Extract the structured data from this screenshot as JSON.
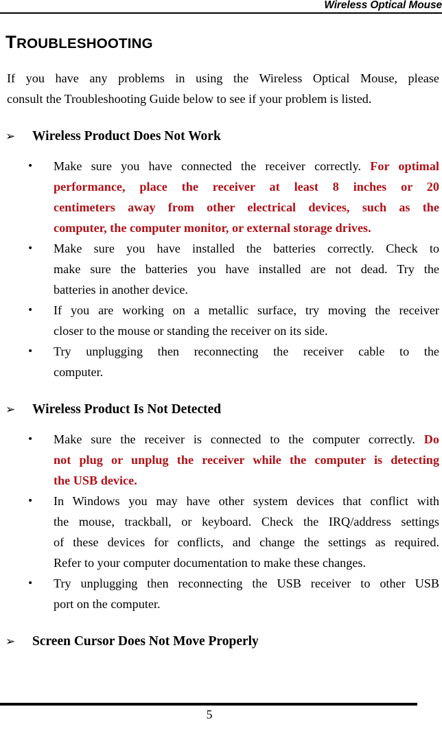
{
  "header": {
    "title": "Wireless Optical Mouse"
  },
  "document": {
    "chapter_title_first_letter": "T",
    "chapter_title_rest": "ROUBLESHOOTING",
    "chapter_title_full": "TROUBLESHOOTING",
    "intro_line_1": "If you have any problems in using the Wireless Optical Mouse, please",
    "intro_line_2": "consult the Troubleshooting Guide below to see if your problem is listed."
  },
  "theme": {
    "text_color": "#000000",
    "emphasis_color": "#B01218",
    "page_background": "#FFFFFF",
    "rule_color": "#000000"
  },
  "icons": {
    "arrow_bullet": "➢",
    "disc_bullet": "•"
  },
  "sections": [
    {
      "heading": "Wireless Product Does Not Work",
      "bullets": [
        {
          "lines": [
            {
              "text": "Make sure you have connected the receiver correctly. ",
              "emphasis": false,
              "justify": true
            },
            {
              "text": "For optimal",
              "emphasis": true,
              "justify": true
            },
            {
              "text": "performance, place the receiver at least 8 inches or 20",
              "emphasis": true,
              "justify": true
            },
            {
              "text": "centimeters away from other electrical devices, such as the",
              "emphasis": true,
              "justify": true
            },
            {
              "text": "computer, the computer monitor, or external storage drives.",
              "emphasis": true,
              "justify": false
            }
          ]
        },
        {
          "lines": [
            {
              "text": "Make sure you have installed the batteries correctly. Check to",
              "emphasis": false,
              "justify": true
            },
            {
              "text": "make sure the batteries you have installed are not dead. Try the",
              "emphasis": false,
              "justify": true
            },
            {
              "text": "batteries in another device.",
              "emphasis": false,
              "justify": false
            }
          ]
        },
        {
          "lines": [
            {
              "text": "If you are working on a metallic surface, try moving the receiver",
              "emphasis": false,
              "justify": true
            },
            {
              "text": "closer to the mouse or standing the receiver on its side.",
              "emphasis": false,
              "justify": false
            }
          ]
        },
        {
          "lines": [
            {
              "text": "Try unplugging then reconnecting the receiver cable to the",
              "emphasis": false,
              "justify": true
            },
            {
              "text": "computer.",
              "emphasis": false,
              "justify": false
            }
          ]
        }
      ]
    },
    {
      "heading": "Wireless Product Is Not Detected",
      "bullets": [
        {
          "lines": [
            {
              "text": "Make sure the receiver is connected to the computer correctly. ",
              "emphasis": false,
              "justify": true
            },
            {
              "text": "Do",
              "emphasis": true,
              "justify": true
            },
            {
              "text": "not plug or unplug the receiver while the computer is detecting",
              "emphasis": true,
              "justify": true
            },
            {
              "text": "the USB device.",
              "emphasis": true,
              "justify": false
            }
          ]
        },
        {
          "lines": [
            {
              "text": "In Windows you may have other system devices that conflict with",
              "emphasis": false,
              "justify": true
            },
            {
              "text": "the mouse, trackball, or keyboard. Check the IRQ/address settings",
              "emphasis": false,
              "justify": true
            },
            {
              "text": "of these devices for conflicts, and change the settings as required.",
              "emphasis": false,
              "justify": true
            },
            {
              "text": "Refer to your computer documentation to make these changes.",
              "emphasis": false,
              "justify": false
            }
          ]
        },
        {
          "lines": [
            {
              "text": "Try unplugging then reconnecting the USB receiver to other USB",
              "emphasis": false,
              "justify": true
            },
            {
              "text": "port on the computer.",
              "emphasis": false,
              "justify": false
            }
          ]
        }
      ]
    },
    {
      "heading": "Screen Cursor Does Not Move Properly",
      "bullets": []
    }
  ],
  "footer": {
    "page_number": "5"
  }
}
